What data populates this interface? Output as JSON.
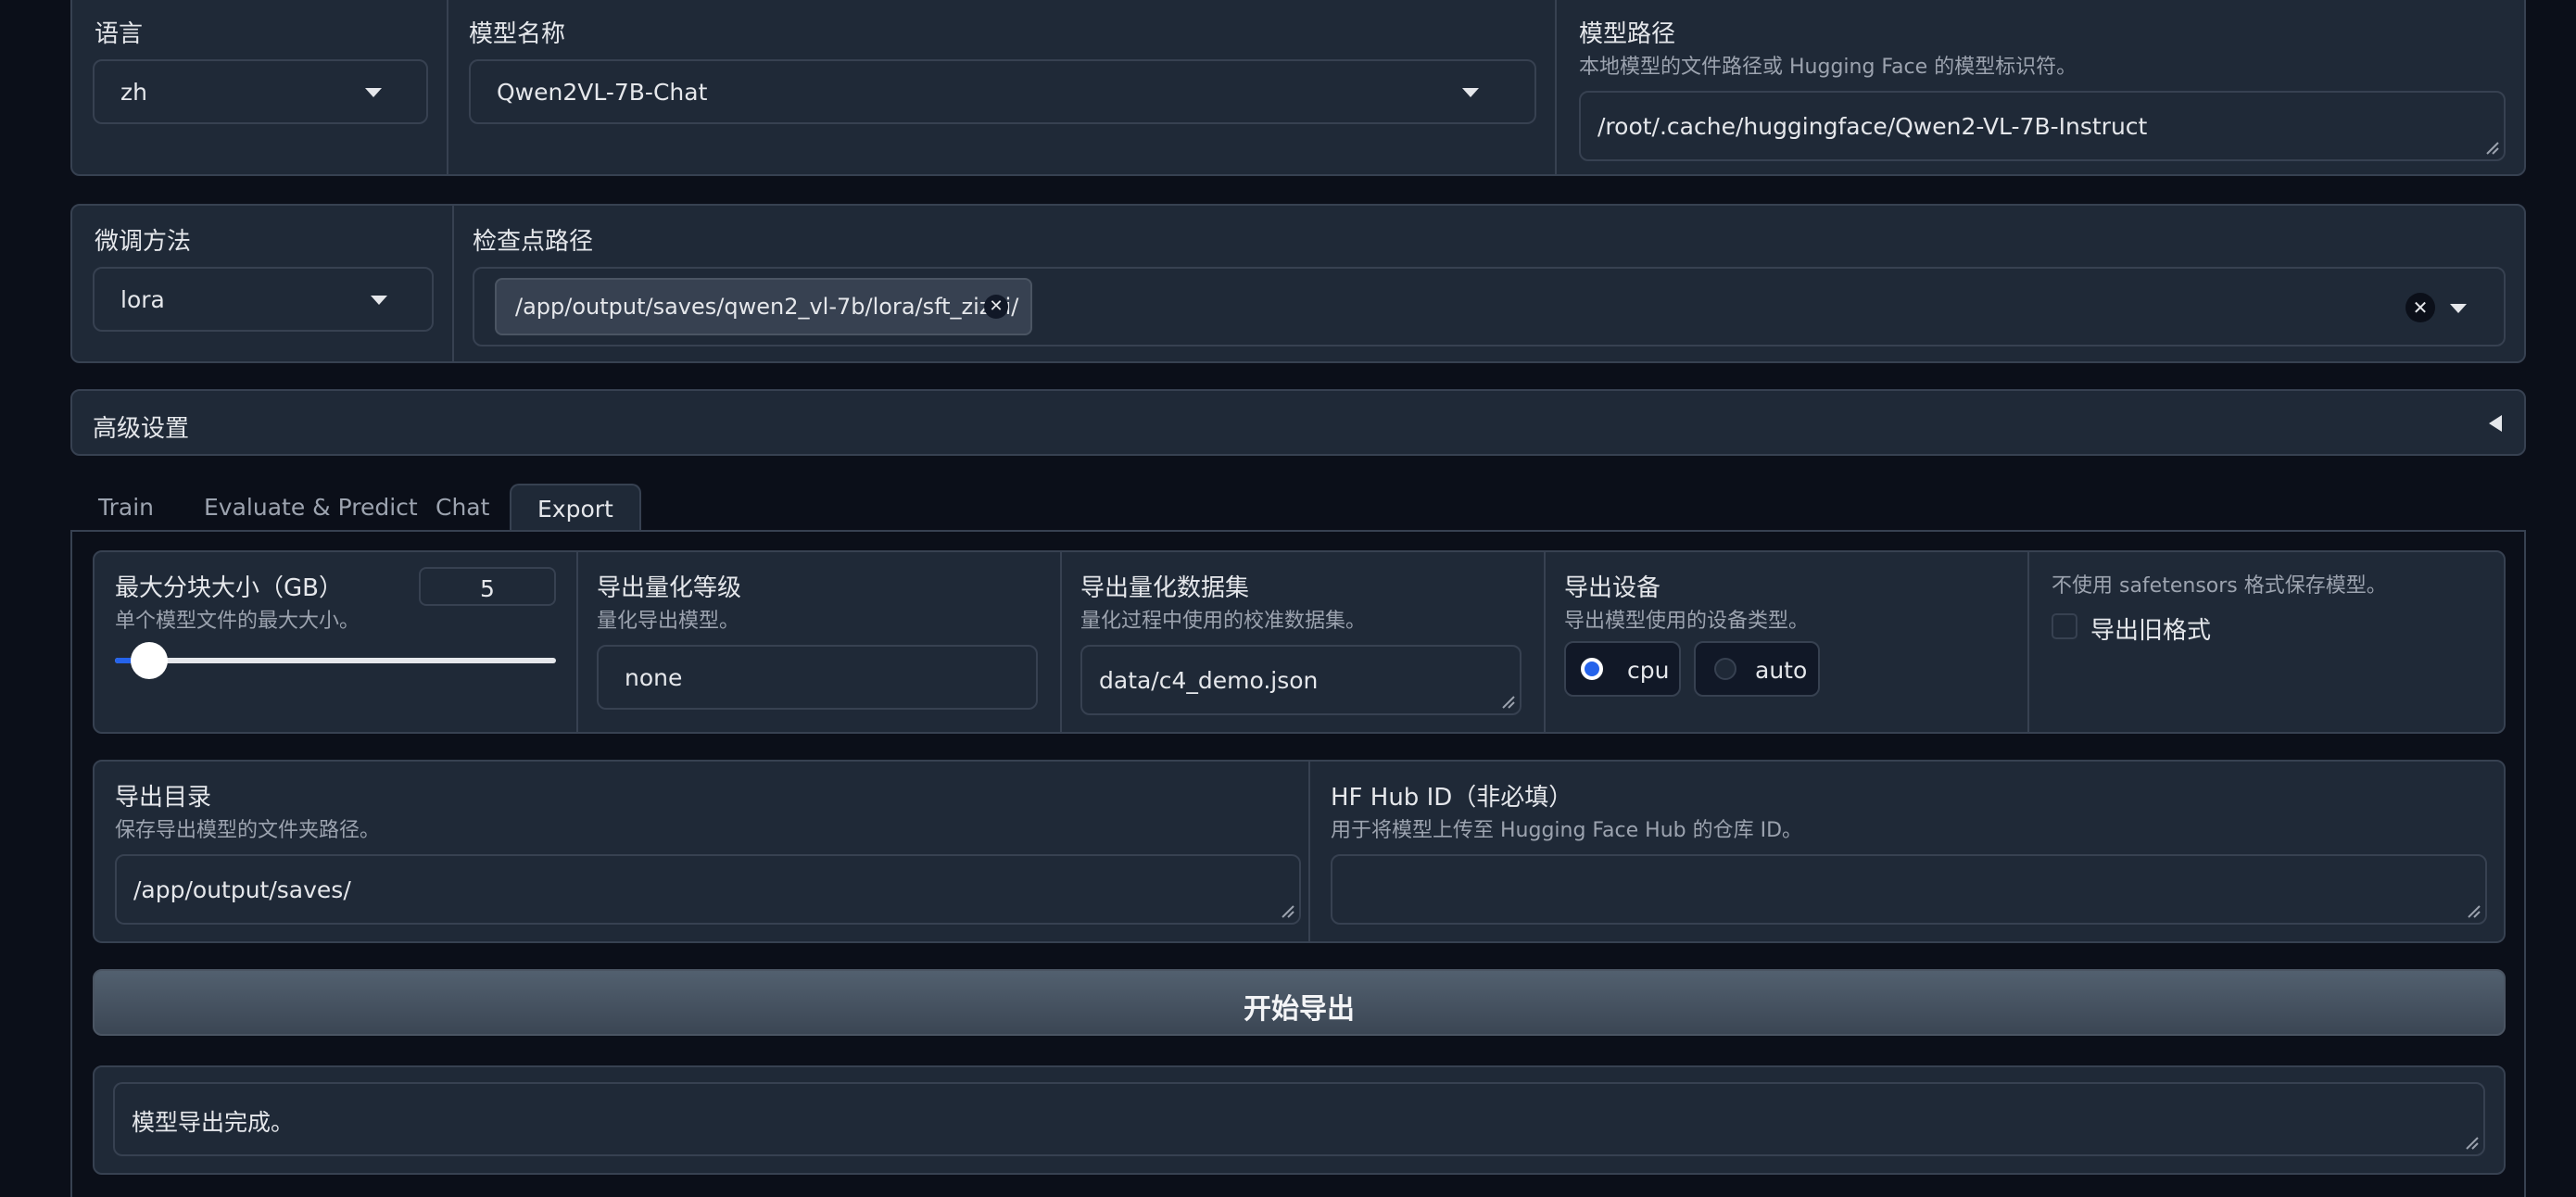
{
  "top": {
    "language": {
      "label": "语言",
      "value": "zh"
    },
    "model_name": {
      "label": "模型名称",
      "value": "Qwen2VL-7B-Chat"
    },
    "model_path": {
      "label": "模型路径",
      "info": "本地模型的文件路径或 Hugging Face 的模型标识符。",
      "value": "/root/.cache/huggingface/Qwen2-VL-7B-Instruct"
    }
  },
  "second": {
    "finetune_method": {
      "label": "微调方法",
      "value": "lora"
    },
    "checkpoint_path": {
      "label": "检查点路径",
      "chip": "/app/output/saves/qwen2_vl-7b/lora/sft_zizhi/"
    }
  },
  "advanced": {
    "label": "高级设置"
  },
  "tabs": [
    {
      "label": "Train"
    },
    {
      "label": "Evaluate & Predict"
    },
    {
      "label": "Chat"
    },
    {
      "label": "Export"
    }
  ],
  "export": {
    "max_shard_size": {
      "label": "最大分块大小（GB）",
      "info": "单个模型文件的最大大小。",
      "value": "5",
      "slider_fraction": 0.04
    },
    "quant_bit": {
      "label": "导出量化等级",
      "info": "量化导出模型。",
      "value": "none"
    },
    "quant_dataset": {
      "label": "导出量化数据集",
      "info": "量化过程中使用的校准数据集。",
      "value": "data/c4_demo.json"
    },
    "device": {
      "label": "导出设备",
      "info": "导出模型使用的设备类型。",
      "options": [
        "cpu",
        "auto"
      ],
      "selected": "cpu"
    },
    "legacy_format": {
      "info": "不使用 safetensors 格式保存模型。",
      "label": "导出旧格式",
      "checked": false
    },
    "export_dir": {
      "label": "导出目录",
      "info": "保存导出模型的文件夹路径。",
      "value": "/app/output/saves/"
    },
    "hub_id": {
      "label": "HF Hub ID（非必填）",
      "info": "用于将模型上传至 Hugging Face Hub 的仓库 ID。",
      "value": ""
    },
    "start_button": "开始导出",
    "output": "模型导出完成。"
  },
  "colors": {
    "accent": "#2563eb",
    "panel": "#1f2937",
    "border": "#374151",
    "background": "#0b0f19"
  }
}
